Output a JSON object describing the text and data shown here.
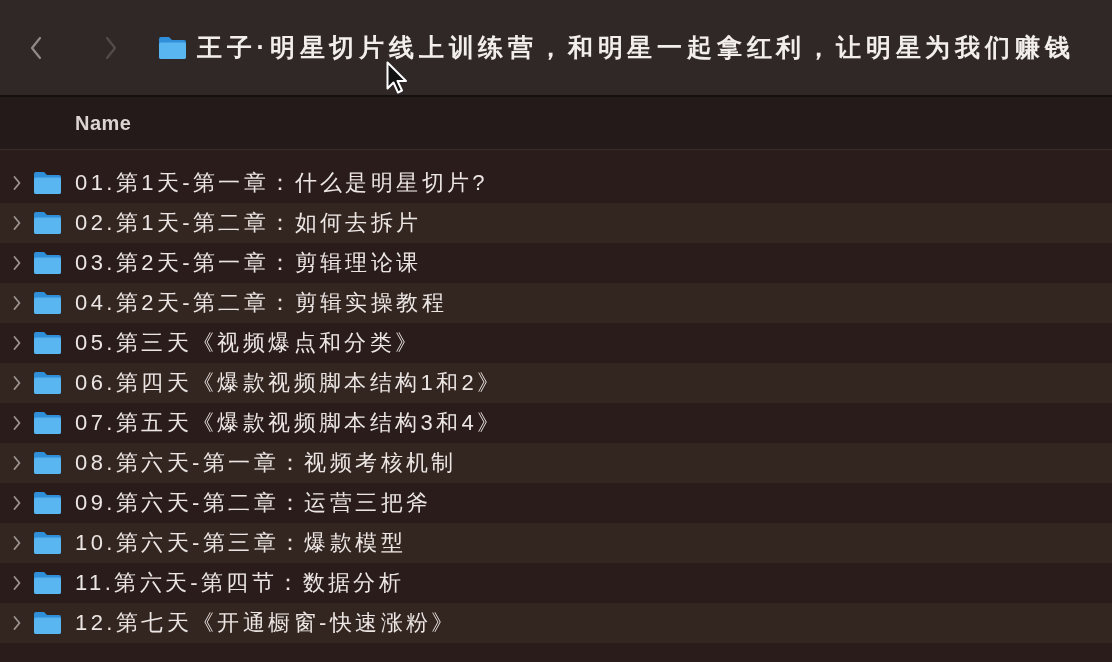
{
  "toolbar": {
    "back": {
      "disabled": false
    },
    "forward": {
      "disabled": true
    },
    "title": "王子·明星切片线上训练营，和明星一起拿红利，让明星为我们赚钱"
  },
  "list": {
    "columns": [
      {
        "label": "Name"
      }
    ],
    "rows": [
      {
        "name": "01.第1天-第一章：什么是明星切片?",
        "expanded": false
      },
      {
        "name": "02.第1天-第二章：如何去拆片",
        "expanded": false
      },
      {
        "name": "03.第2天-第一章：剪辑理论课",
        "expanded": false
      },
      {
        "name": "04.第2天-第二章：剪辑实操教程",
        "expanded": false
      },
      {
        "name": "05.第三天《视频爆点和分类》",
        "expanded": false
      },
      {
        "name": "06.第四天《爆款视频脚本结构1和2》",
        "expanded": false
      },
      {
        "name": "07.第五天《爆款视频脚本结构3和4》",
        "expanded": false
      },
      {
        "name": "08.第六天-第一章：视频考核机制",
        "expanded": false
      },
      {
        "name": "09.第六天-第二章：运营三把斧",
        "expanded": false
      },
      {
        "name": "10.第六天-第三章：爆款模型",
        "expanded": false
      },
      {
        "name": "11.第六天-第四节：数据分析",
        "expanded": false
      },
      {
        "name": "12.第七天《开通橱窗-快速涨粉》",
        "expanded": false
      }
    ]
  }
}
